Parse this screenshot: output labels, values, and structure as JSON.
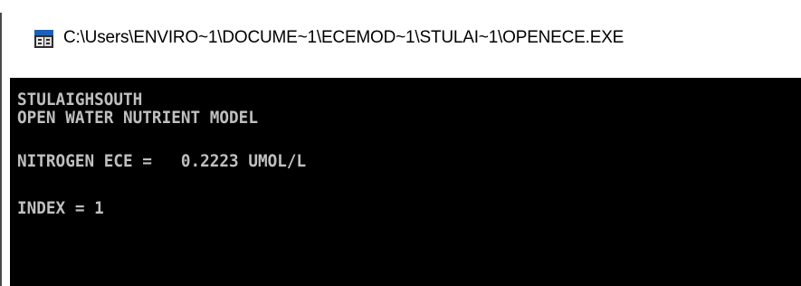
{
  "window": {
    "title": "C:\\Users\\ENVIRO~1\\DOCUME~1\\ECEMOD~1\\STULAI~1\\OPENECE.EXE",
    "icon": "console-app-icon"
  },
  "console": {
    "lines": [
      "STULAIGHSOUTH",
      "OPEN WATER NUTRIENT MODEL",
      "NITROGEN ECE =   0.2223 UMOL/L",
      "INDEX = 1"
    ],
    "background_color": "#000000",
    "text_color": "#c0c0c0"
  }
}
